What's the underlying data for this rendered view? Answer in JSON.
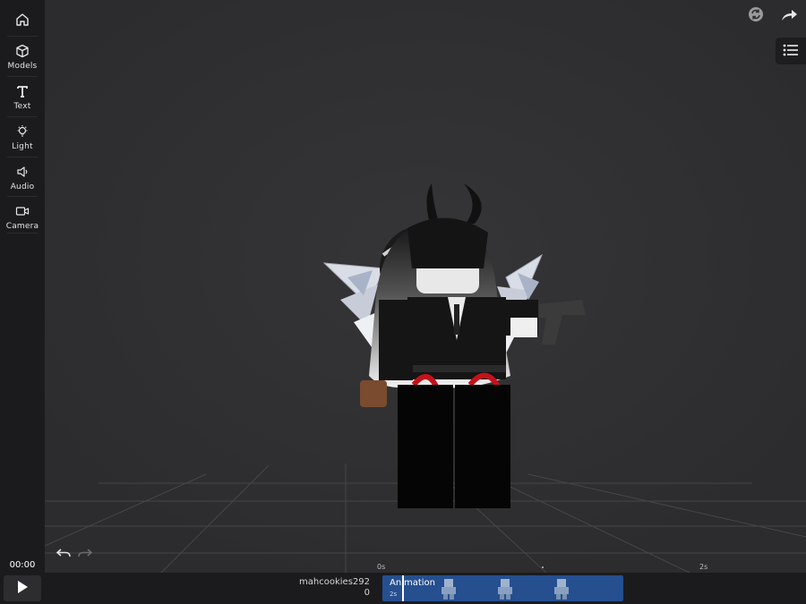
{
  "sidebar": {
    "items": [
      {
        "label": "",
        "icon": "home-icon"
      },
      {
        "label": "Models",
        "icon": "cube-icon"
      },
      {
        "label": "Text",
        "icon": "text-icon"
      },
      {
        "label": "Light",
        "icon": "lightbulb-icon"
      },
      {
        "label": "Audio",
        "icon": "speaker-icon"
      },
      {
        "label": "Camera",
        "icon": "video-camera-icon"
      }
    ]
  },
  "toolbar": {
    "refresh_icon": "refresh-icon",
    "share_icon": "share-arrow-icon",
    "list_icon": "list-icon"
  },
  "timeline": {
    "current_time": "00:00",
    "tick_start": "0s",
    "tick_end": "2s",
    "track_owner": "mahcookies292",
    "track_count": "0",
    "clip_title": "Animation",
    "clip_duration": "2s"
  },
  "colors": {
    "sidebar_bg": "#1b1b1d",
    "viewport_bg": "#2e2e30",
    "clip_blue": "#254f8f",
    "grid_line": "#4a4a4c"
  }
}
